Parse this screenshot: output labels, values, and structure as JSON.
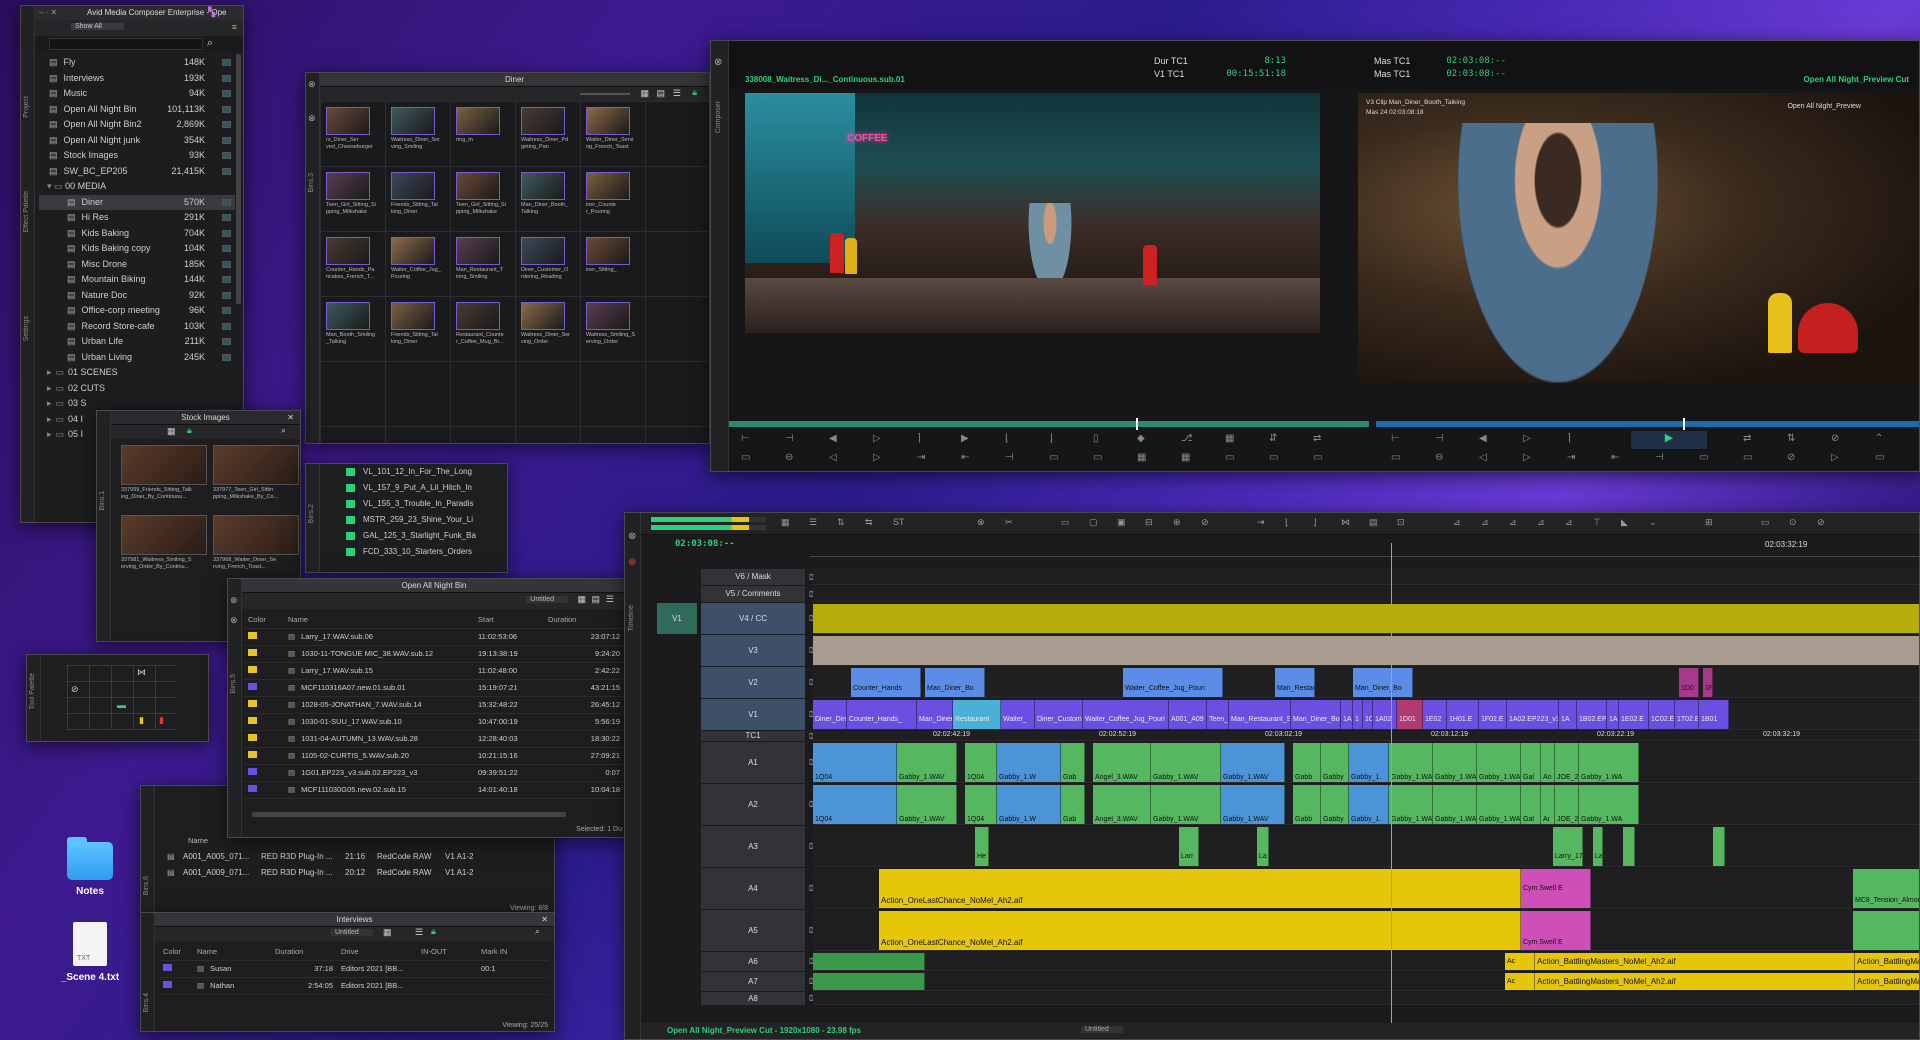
{
  "project": {
    "title": "Avid Media Composer Enterprise - Ope",
    "filter": "Show All",
    "side_tabs": [
      "Project",
      "Effect Palette",
      "Settings"
    ],
    "bins": [
      {
        "name": "Fly",
        "size": "148K"
      },
      {
        "name": "Interviews",
        "size": "193K"
      },
      {
        "name": "Music",
        "size": "94K"
      },
      {
        "name": "Open All Night Bin",
        "size": "101,113K"
      },
      {
        "name": "Open All Night Bin2",
        "size": "2,869K"
      },
      {
        "name": "Open All Night junk",
        "size": "354K"
      },
      {
        "name": "Stock Images",
        "size": "93K"
      },
      {
        "name": "SW_BC_EP205",
        "size": "21,415K"
      }
    ],
    "media_folder": "00 MEDIA",
    "media_bins": [
      {
        "name": "Diner",
        "size": "570K"
      },
      {
        "name": "Hi Res",
        "size": "291K"
      },
      {
        "name": "Kids Baking",
        "size": "704K"
      },
      {
        "name": "Kids Baking copy",
        "size": "104K"
      },
      {
        "name": "Misc Drone",
        "size": "185K"
      },
      {
        "name": "Mountain Biking",
        "size": "144K"
      },
      {
        "name": "Nature Doc",
        "size": "92K"
      },
      {
        "name": "Office-corp meeting",
        "size": "96K"
      },
      {
        "name": "Record Store-cafe",
        "size": "103K"
      },
      {
        "name": "Urban Life",
        "size": "211K"
      },
      {
        "name": "Urban Living",
        "size": "245K"
      }
    ],
    "folders": [
      "01 SCENES",
      "02 CUTS",
      "03 S",
      "04 I",
      "05 I"
    ]
  },
  "diner_bin": {
    "title": "Diner",
    "side_tab": "Bins.3",
    "thumb_captions": [
      "rs_Diner_Ser ved_Cheeseburger",
      "Waitress_Diner_Ser ving_Smiling",
      "ring_m",
      "Waitress_Diner_Pd geting_Pan",
      "Waiter_Diner_Servi ng_French_Toast",
      "Teen_Girl_Sitting_Si pping_Milkshake",
      "Friends_Sitting_Tal king_Diner",
      "Teen_Girl_Sitting_Si pping_Milkshake",
      "Man_Diner_Booth_ Talking",
      "iner_Counte r_Pouring",
      "Counter_Hands_Pa ncakes_French_T...",
      "Waiter_Coffee_Jug_ Pouring",
      "Man_Restaurant_T iring_Smiling",
      "Diner_Customer_O rdering_Reading",
      "iner_Sitting_",
      "Man_Booth_Smiling _Talking",
      "Friends_Sitting_Tal king_Diner",
      "Restaurant_Counte r_Coffee_Mug_Br...",
      "Waitress_Diner_Ser ving_Order",
      "Waitress_Smiling_S erving_Order"
    ]
  },
  "stock_bin": {
    "title": "Stock Images",
    "side_tab": "Bins.1",
    "captions": [
      "337999_Friends_Sitting_Talk ing_Diner_By_Continuou...",
      "337977_Teen_Girl_Sittin pping_Milkshake_By_Co...",
      "337981_Waitress_Smiling_S erving_Order_By_Continu...",
      "337968_Waiter_Diner_Se rving_French_Toast..."
    ]
  },
  "small_list": {
    "side_tab": "Bins.2",
    "items": [
      "VL_101_12_In_For_The_Long",
      "VL_157_9_Put_A_Lil_Hitch_In",
      "VL_155_3_Trouble_In_Paradis",
      "MSTR_259_23_Shine_Your_Li",
      "GAL_125_3_Starlight_Funk_Ba",
      "FCD_333_10_Starters_Orders"
    ]
  },
  "night_bin": {
    "title": "Open All Night Bin",
    "side_tab": "Bins.5",
    "view": "Untitled",
    "columns": [
      "Color",
      "Name",
      "Start",
      "Duration"
    ],
    "rows": [
      {
        "color": "#e3c52a",
        "name": "Larry_17.WAV.sub.06",
        "start": "11:02:53:06",
        "duration": "23:07:12"
      },
      {
        "color": "#e3c52a",
        "name": "1030-11-TONGUE MIC_38.WAV.sub.12",
        "start": "19:13:38:19",
        "duration": "9:24:20"
      },
      {
        "color": "#e3c52a",
        "name": "Larry_17.WAV.sub.15",
        "start": "11:02:48:00",
        "duration": "2:42:22"
      },
      {
        "color": "#6a4fe0",
        "name": "MCF110316A07.new.01.sub.01",
        "start": "15:19:07:21",
        "duration": "43:21:15"
      },
      {
        "color": "#e3c52a",
        "name": "1028-05-JONATHAN_7.WAV.sub.14",
        "start": "15:32:48:22",
        "duration": "26:45:12"
      },
      {
        "color": "#e3c52a",
        "name": "1030-01-SUU_17.WAV.sub.10",
        "start": "10:47:00:19",
        "duration": "5:56:19"
      },
      {
        "color": "#e3c52a",
        "name": "1031-04-AUTUMN_13.WAV.sub.28",
        "start": "12:28:40:03",
        "duration": "18:30:22"
      },
      {
        "color": "#e3c52a",
        "name": "1105-02-CURTIS_5.WAV.sub.20",
        "start": "10:21:15:16",
        "duration": "27:09:21"
      },
      {
        "color": "#6a4fe0",
        "name": "1G01.EP223_v3.sub.02.EP223_v3",
        "start": "09:39:51:22",
        "duration": "0:07"
      },
      {
        "color": "#6a4fe0",
        "name": "MCF111030G05.new.02.sub.15",
        "start": "14:01:40:18",
        "duration": "10:04:18"
      }
    ],
    "status": "Selected: 1 Du"
  },
  "red_bin": {
    "side_tab": "Bins.6",
    "columns": [
      "Name"
    ],
    "rows": [
      {
        "name": "A001_A005_071...",
        "plugin": "RED R3D Plug-In ...",
        "dur": "21:16",
        "codec": "RedCode RAW",
        "tracks": "V1 A1-2"
      },
      {
        "name": "A001_A009_071...",
        "plugin": "RED R3D Plug-In ...",
        "dur": "20:12",
        "codec": "RedCode RAW",
        "tracks": "V1 A1-2"
      }
    ],
    "status": "Viewing: 8/8"
  },
  "interviews_bin": {
    "title": "Interviews",
    "side_tab": "Bins.4",
    "view": "Untitled",
    "columns": [
      "Color",
      "Name",
      "Duration",
      "Drive",
      "IN-OUT",
      "Mark IN"
    ],
    "rows": [
      {
        "color": "#6a4fe0",
        "name": "Susan",
        "duration": "37:18",
        "drive": "Editors 2021 [BB...",
        "markin": "00:1"
      },
      {
        "color": "#6a4fe0",
        "name": "Nathan",
        "duration": "2:54:05",
        "drive": "Editors 2021 [BB...",
        "markin": ""
      }
    ],
    "status": "Viewing: 25/25"
  },
  "tool_palette": {
    "side_tab": "Tool Palette"
  },
  "desktop": {
    "icons": [
      {
        "label": "Notes"
      },
      {
        "label": "_Scene 4.txt",
        "badge": "TXT"
      }
    ]
  },
  "composer": {
    "side_tab": "Composer",
    "source_clip": "338008_Waitress_Di..._Continuous.sub.01",
    "dur_label": "Dur TC1",
    "dur_value": "8:13",
    "v1_label": "V1 TC1",
    "v1_value": "00:15:51:18",
    "mas_label1": "Mas TC1",
    "mas_value1": "02:03:08:--",
    "mas_label2": "Mas TC1",
    "mas_value2": "02:03:08:--",
    "sequence": "Open All Night_Preview Cut",
    "record_overlay_title": "Open All Night_Preview",
    "overlay_line1": "V3 Clip Man_Diner_Booth_Talking",
    "overlay_line2": "Mas 24  02:03:08:18",
    "neon": "COFFEE"
  },
  "timeline": {
    "side_tab": "Timeline",
    "timecode": "02:03:08:--",
    "ruler_tc": "02:03:32:19",
    "tracks": [
      {
        "name": "V6 / Mask"
      },
      {
        "name": "V5 / Comments"
      },
      {
        "name": "V4 / CC",
        "src": "V1"
      },
      {
        "name": "V3"
      },
      {
        "name": "V2"
      },
      {
        "name": "V1"
      },
      {
        "name": "TC1"
      },
      {
        "name": "A1"
      },
      {
        "name": "A2"
      },
      {
        "name": "A3"
      },
      {
        "name": "A4"
      },
      {
        "name": "A5"
      },
      {
        "name": "A6"
      },
      {
        "name": "A7"
      },
      {
        "name": "A8"
      }
    ],
    "tc_marks": [
      "02:02:42:19",
      "02:02:52:19",
      "02:03:02:19",
      "02:03:12:19",
      "02:03:22:19",
      "02:03:32:19"
    ],
    "v2_clips": [
      "Counter_Hands",
      "Man_Diner_Bo",
      "Waiter_Coffee_Jug_Pouri",
      "Man_Restaurant_S",
      "Man_Diner_Bo",
      "1D0",
      "1F"
    ],
    "v1_clips": [
      "Diner_Din",
      "Counter_Hands_",
      "Man_Diner_Co",
      "Restaurant",
      "Waiter_",
      "Diner_Custom",
      "Waiter_Coffee_Jug_Pouri",
      "A001_A09",
      "Teen_",
      "Man_Restaurant_S",
      "Man_Diner_Boo",
      "1A",
      "1",
      "1C",
      "1A02",
      "1D01",
      "1E02",
      "1H01.E",
      "1F02.E",
      "1A02.EP223_v3",
      "1A",
      "1B02.EP",
      "1A",
      "1E02.E",
      "1C02.EP",
      "1T02.E",
      "1B01"
    ],
    "a1_clips": [
      "1Q04",
      "Gabby_1.WAV",
      "1Q04",
      "Gabby_1.W",
      "Gab",
      "Angel_3.WAV",
      "Gabby_1.WAV",
      "Gabby_1.WAV",
      "Gabb",
      "Gabby",
      "Gabby_1.",
      "Gabby_1.WA",
      "Gabby_1.WA",
      "Gabby_1.WA",
      "Gal",
      "An",
      "JOE_2",
      "Gabby_1.WA"
    ],
    "a2_clips": [
      "1Q04",
      "Gabby_1.WAV",
      "1Q04",
      "Gabby_1.W",
      "Gab",
      "Angel_3.WAV",
      "Gabby_1.WAV",
      "Gabby_1.WAV",
      "Gabb",
      "Gabby",
      "Gabby_1.",
      "Gabby_1.WA",
      "Gabby_1.WA",
      "Gabby_1.WA",
      "Gal",
      "Ar",
      "JOE_2",
      "Gabby_1.WA"
    ],
    "a3_clips": [
      "He",
      "Larr",
      "La",
      "Larry_17.",
      "La"
    ],
    "a4_clip": "Action_OneLastChance_NoMel_Ah2.aif",
    "a5_clip": "Action_OneLastChance_NoMel_Ah2.aif",
    "cym_clip": "Cym Swell E",
    "cym_short": "Cym",
    "mc8_clip": "MC8_Tension_Almond",
    "a67_clip": "Action_BattlingMasters_NoMel_Ah2.aif",
    "a67_right": "Action_BattlingMaste",
    "ac": "Ac",
    "status": "Open All Night_Preview Cut - 1920x1080 - 23.98 fps",
    "status_view": "Untitled"
  },
  "colors": {
    "accent_green": "#2fd07a",
    "video_clip": "#6a4fe0",
    "v2_clip": "#5b8de6",
    "audio_green": "#55b860",
    "audio_blue": "#4c94d8",
    "music_yellow": "#e6c60a",
    "music_pink": "#cf4fb8"
  }
}
